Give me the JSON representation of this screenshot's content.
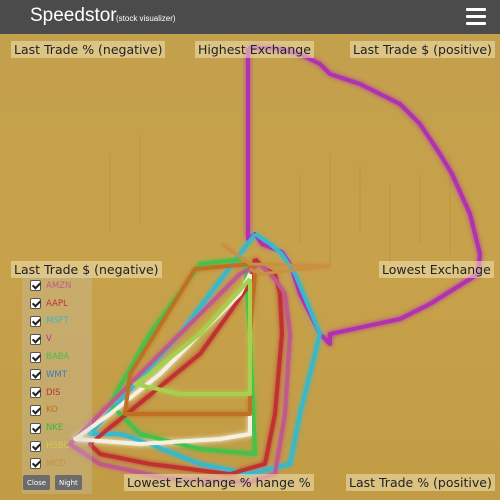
{
  "header": {
    "title": "Speedstor",
    "subtitle": "(stock visualizer)"
  },
  "axes": {
    "top_left": "Last Trade % (negative)",
    "top": "Highest Exchange",
    "top_right": "Last Trade $ (positive)",
    "left": "Last Trade $ (negative)",
    "right": "Lowest Exchange",
    "bottom": "Lowest Exchange % hange %",
    "bottom_right": "Last Trade % (positive)"
  },
  "legend": {
    "items": [
      {
        "label": "AMZN",
        "color": "#c05a8a"
      },
      {
        "label": "AAPL",
        "color": "#c0303a"
      },
      {
        "label": "MSFT",
        "color": "#38b8c8"
      },
      {
        "label": "V",
        "color": "#b030b0"
      },
      {
        "label": "BABA",
        "color": "#48c048"
      },
      {
        "label": "WMT",
        "color": "#3878c0"
      },
      {
        "label": "DIS",
        "color": "#c03030"
      },
      {
        "label": "KO",
        "color": "#c07020"
      },
      {
        "label": "NKE",
        "color": "#38b838"
      },
      {
        "label": "HSBC",
        "color": "#d8c850"
      },
      {
        "label": "MCD",
        "color": "#c89040"
      }
    ],
    "close_label": "Close",
    "night_label": "Night"
  },
  "colors": {
    "topbar": "#4b4b4b",
    "background": "#c4a048"
  }
}
